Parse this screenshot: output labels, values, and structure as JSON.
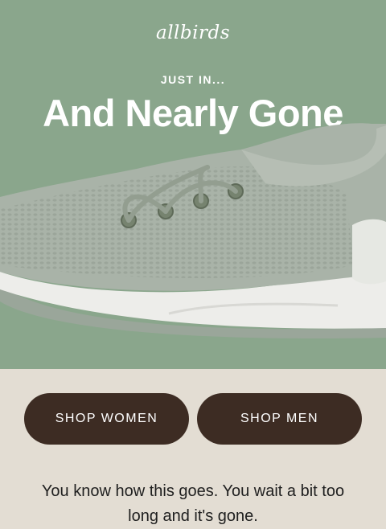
{
  "brand": {
    "logo_text": "allbirds"
  },
  "hero": {
    "eyebrow": "JUST IN...",
    "headline": "And Nearly Gone",
    "background_color": "#8aa68c",
    "image": "sneaker-image"
  },
  "buttons": {
    "shop_women": "SHOP WOMEN",
    "shop_men": "SHOP MEN",
    "color": "#3d2c23"
  },
  "body": {
    "text": "You know how this goes. You wait a bit too long and it's gone."
  }
}
